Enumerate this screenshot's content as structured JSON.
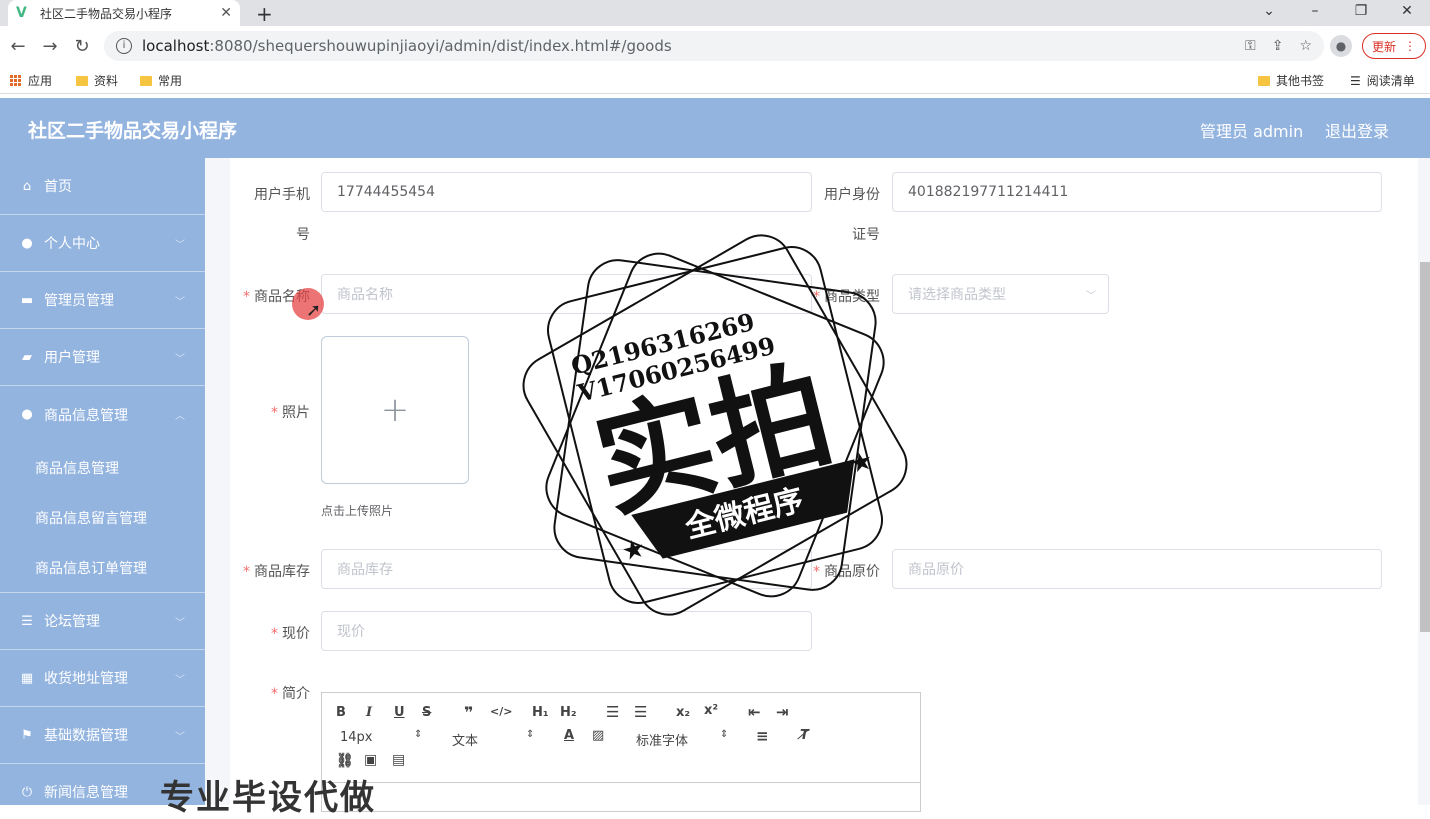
{
  "browser": {
    "tab_title": "社区二手物品交易小程序",
    "url_host": "localhost",
    "url_rest": ":8080/shequershouwupinjiaoyi/admin/dist/index.html#/goods",
    "update_label": "更新",
    "bookmarks": [
      "应用",
      "资料",
      "常用"
    ],
    "bookmarks_right": [
      "其他书签",
      "阅读清单"
    ]
  },
  "header": {
    "title": "社区二手物品交易小程序",
    "admin": "管理员 admin",
    "logout": "退出登录"
  },
  "sidebar": {
    "items": [
      {
        "label": "首页",
        "icon": "home-icon"
      },
      {
        "label": "个人中心",
        "icon": "user-icon"
      },
      {
        "label": "管理员管理",
        "icon": "briefcase-icon"
      },
      {
        "label": "用户管理",
        "icon": "ticket-icon"
      },
      {
        "label": "商品信息管理",
        "icon": "user-icon"
      }
    ],
    "sub_items": [
      "商品信息管理",
      "商品信息留言管理",
      "商品信息订单管理"
    ],
    "items_after": [
      {
        "label": "论坛管理",
        "icon": "list-icon"
      },
      {
        "label": "收货地址管理",
        "icon": "grid-icon"
      },
      {
        "label": "基础数据管理",
        "icon": "flag-icon"
      },
      {
        "label": "新闻信息管理",
        "icon": "power-icon"
      }
    ]
  },
  "form": {
    "phone_label_1": "用户手机",
    "phone_label_2": "号",
    "phone_value": "17744455454",
    "idcard_label_1": "用户身份",
    "idcard_label_2": "证号",
    "idcard_value": "401882197711214411",
    "name_label": "商品名称",
    "name_placeholder": "商品名称",
    "type_label": "商品类型",
    "type_placeholder": "请选择商品类型",
    "photo_label": "照片",
    "upload_tip": "点击上传照片",
    "stock_label": "商品库存",
    "stock_placeholder": "商品库存",
    "orig_label": "商品原价",
    "orig_placeholder": "商品原价",
    "price_label": "现价",
    "price_placeholder": "现价",
    "intro_label": "简介",
    "required_mark": "*"
  },
  "editor": {
    "font_size": "14px",
    "text_type": "文本",
    "font_family": "标准字体"
  },
  "watermark": {
    "line1": "Q2196316269",
    "line2": "V17060256499",
    "big": "实拍",
    "banner": "全微程序",
    "bottom": "专业毕设代做"
  },
  "colors": {
    "header_bg": "#94b4e0",
    "required": "#f56c6c"
  }
}
